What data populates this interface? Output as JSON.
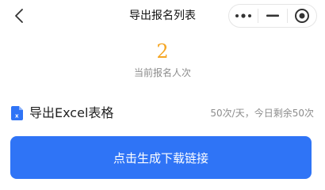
{
  "navbar": {
    "title": "导出报名列表",
    "back_icon": "chevron-left-icon",
    "more_icon": "more-dots-icon",
    "minimize_icon": "minimize-icon",
    "close_icon": "target-circle-icon"
  },
  "summary": {
    "count": "2",
    "count_color": "#f5a623",
    "count_label": "当前报名人次"
  },
  "export": {
    "icon": "excel-file-icon",
    "label": "导出Excel表格",
    "quota": "50次/天，今日剩余50次"
  },
  "action": {
    "button_label": "点击生成下载链接",
    "button_color": "#2f74f6"
  }
}
